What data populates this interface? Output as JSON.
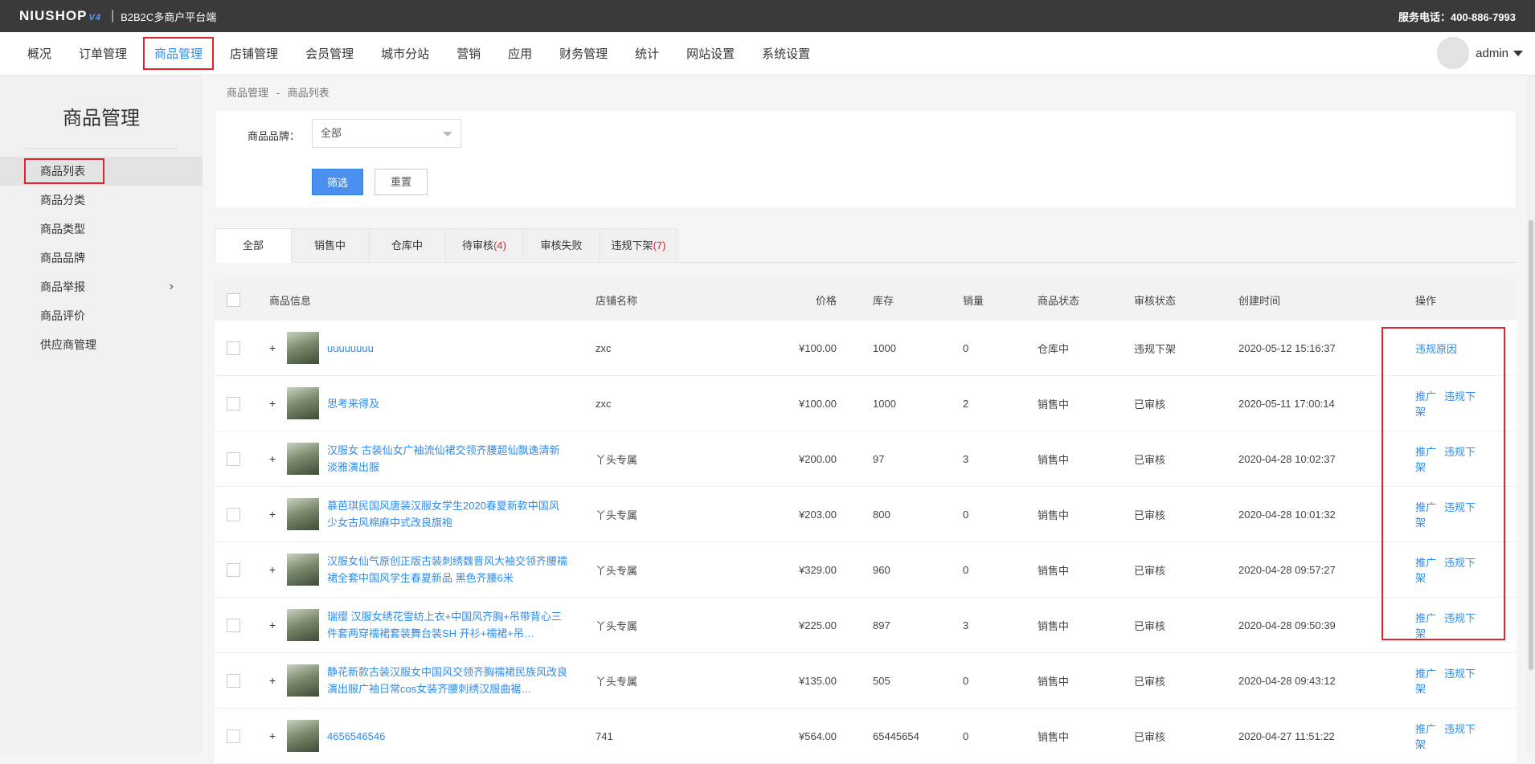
{
  "topbar": {
    "logo": "NIUSHOP",
    "logo_version": "V4",
    "subtitle": "B2B2C多商户平台端",
    "hotline": "服务电话：400-886-7993"
  },
  "nav": {
    "items": [
      "概况",
      "订单管理",
      "商品管理",
      "店铺管理",
      "会员管理",
      "城市分站",
      "营销",
      "应用",
      "财务管理",
      "统计",
      "网站设置",
      "系统设置"
    ],
    "active": "商品管理",
    "username": "admin"
  },
  "sidebar": {
    "title": "商品管理",
    "items": [
      {
        "label": "商品列表"
      },
      {
        "label": "商品分类"
      },
      {
        "label": "商品类型"
      },
      {
        "label": "商品品牌"
      },
      {
        "label": "商品举报"
      },
      {
        "label": "商品评价"
      },
      {
        "label": "供应商管理"
      }
    ]
  },
  "breadcrumb": {
    "root": "商品管理",
    "sep": "-",
    "current": "商品列表"
  },
  "filter": {
    "brand_label": "商品品牌：",
    "brand_value": "全部",
    "search_button": "筛选",
    "reset_button": "重置"
  },
  "tabs": [
    {
      "label": "全部",
      "count": ""
    },
    {
      "label": "销售中",
      "count": ""
    },
    {
      "label": "仓库中",
      "count": ""
    },
    {
      "label": "待审核",
      "count": "(4)"
    },
    {
      "label": "审核失败",
      "count": ""
    },
    {
      "label": "违规下架",
      "count": "(7)"
    }
  ],
  "table": {
    "headers": {
      "info": "商品信息",
      "shop": "店铺名称",
      "price": "价格",
      "stock": "库存",
      "sales": "销量",
      "status": "商品状态",
      "audit": "审核状态",
      "time": "创建时间",
      "op": "操作"
    },
    "rows": [
      {
        "name": "uuuuuuuu",
        "shop": "zxc",
        "price": "¥100.00",
        "stock": "1000",
        "sales": "0",
        "status": "仓库中",
        "audit": "违规下架",
        "time": "2020-05-12 15:16:37",
        "op1": "违规原因",
        "op2": ""
      },
      {
        "name": "思考来得及",
        "shop": "zxc",
        "price": "¥100.00",
        "stock": "1000",
        "sales": "2",
        "status": "销售中",
        "audit": "已审核",
        "time": "2020-05-11 17:00:14",
        "op1": "推广",
        "op2": "违规下架"
      },
      {
        "name": "汉服女 古装仙女广袖流仙裙交领齐腰超仙飘逸清新淡雅演出服",
        "shop": "丫头专属",
        "price": "¥200.00",
        "stock": "97",
        "sales": "3",
        "status": "销售中",
        "audit": "已审核",
        "time": "2020-04-28 10:02:37",
        "op1": "推广",
        "op2": "违规下架"
      },
      {
        "name": "慕芭琪民国风唐装汉服女学生2020春夏新款中国风少女古风棉麻中式改良旗袍",
        "shop": "丫头专属",
        "price": "¥203.00",
        "stock": "800",
        "sales": "0",
        "status": "销售中",
        "audit": "已审核",
        "time": "2020-04-28 10:01:32",
        "op1": "推广",
        "op2": "违规下架"
      },
      {
        "name": "汉服女仙气原创正版古装刺绣魏晋风大袖交领齐腰襦裙全套中国风学生春夏新品 黑色齐腰6米",
        "shop": "丫头专属",
        "price": "¥329.00",
        "stock": "960",
        "sales": "0",
        "status": "销售中",
        "audit": "已审核",
        "time": "2020-04-28 09:57:27",
        "op1": "推广",
        "op2": "违规下架"
      },
      {
        "name": "瑞缨 汉服女绣花雪纺上衣+中国风齐胸+吊带背心三件套两穿襦裙套装舞台装SH 开衫+襦裙+吊…",
        "shop": "丫头专属",
        "price": "¥225.00",
        "stock": "897",
        "sales": "3",
        "status": "销售中",
        "audit": "已审核",
        "time": "2020-04-28 09:50:39",
        "op1": "推广",
        "op2": "违规下架"
      },
      {
        "name": "静花新款古装汉服女中国风交领齐胸襦裙民族风改良演出服广袖日常cos女装齐腰刺绣汉服曲裾…",
        "shop": "丫头专属",
        "price": "¥135.00",
        "stock": "505",
        "sales": "0",
        "status": "销售中",
        "audit": "已审核",
        "time": "2020-04-28 09:43:12",
        "op1": "推广",
        "op2": "违规下架"
      },
      {
        "name": "4656546546",
        "shop": "741",
        "price": "¥564.00",
        "stock": "65445654",
        "sales": "0",
        "status": "销售中",
        "audit": "已审核",
        "time": "2020-04-27 11:51:22",
        "op1": "推广",
        "op2": "违规下架"
      }
    ]
  }
}
